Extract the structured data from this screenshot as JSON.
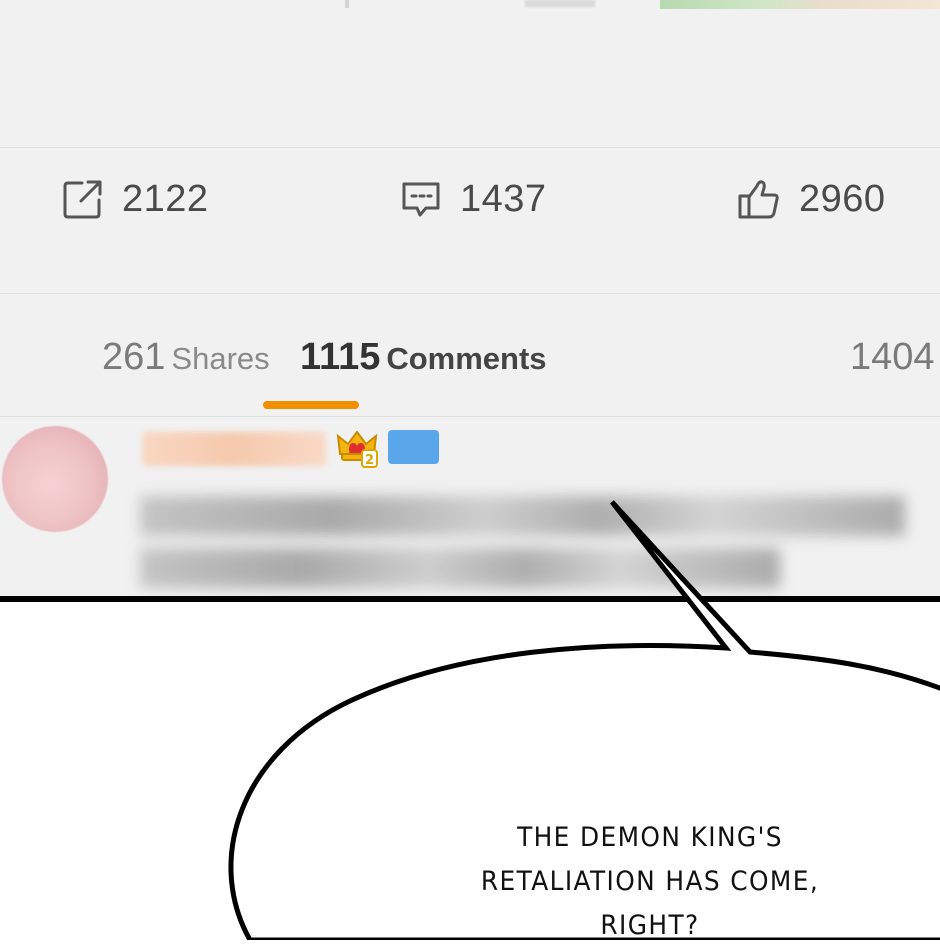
{
  "action_bar": {
    "repost": {
      "icon": "share-icon",
      "count": "2122"
    },
    "comment": {
      "icon": "comment-icon",
      "count": "1437"
    },
    "like": {
      "icon": "thumbs-up-icon",
      "count": "2960"
    }
  },
  "tabs": [
    {
      "count": "261",
      "label": "Shares",
      "active": false
    },
    {
      "count": "1115",
      "label": "Comments",
      "active": true
    },
    {
      "count": "1404",
      "label": "",
      "active": false
    }
  ],
  "accent_color": "#f28f00",
  "comment": {
    "avatar": "blurred-avatar",
    "badges": [
      "vip-crown-icon",
      "blue-badge"
    ],
    "text_blurred": true
  },
  "speech_bubble": {
    "lines": [
      "THE DEMON KING'S",
      "RETALIATION HAS COME,",
      "RIGHT?"
    ]
  }
}
